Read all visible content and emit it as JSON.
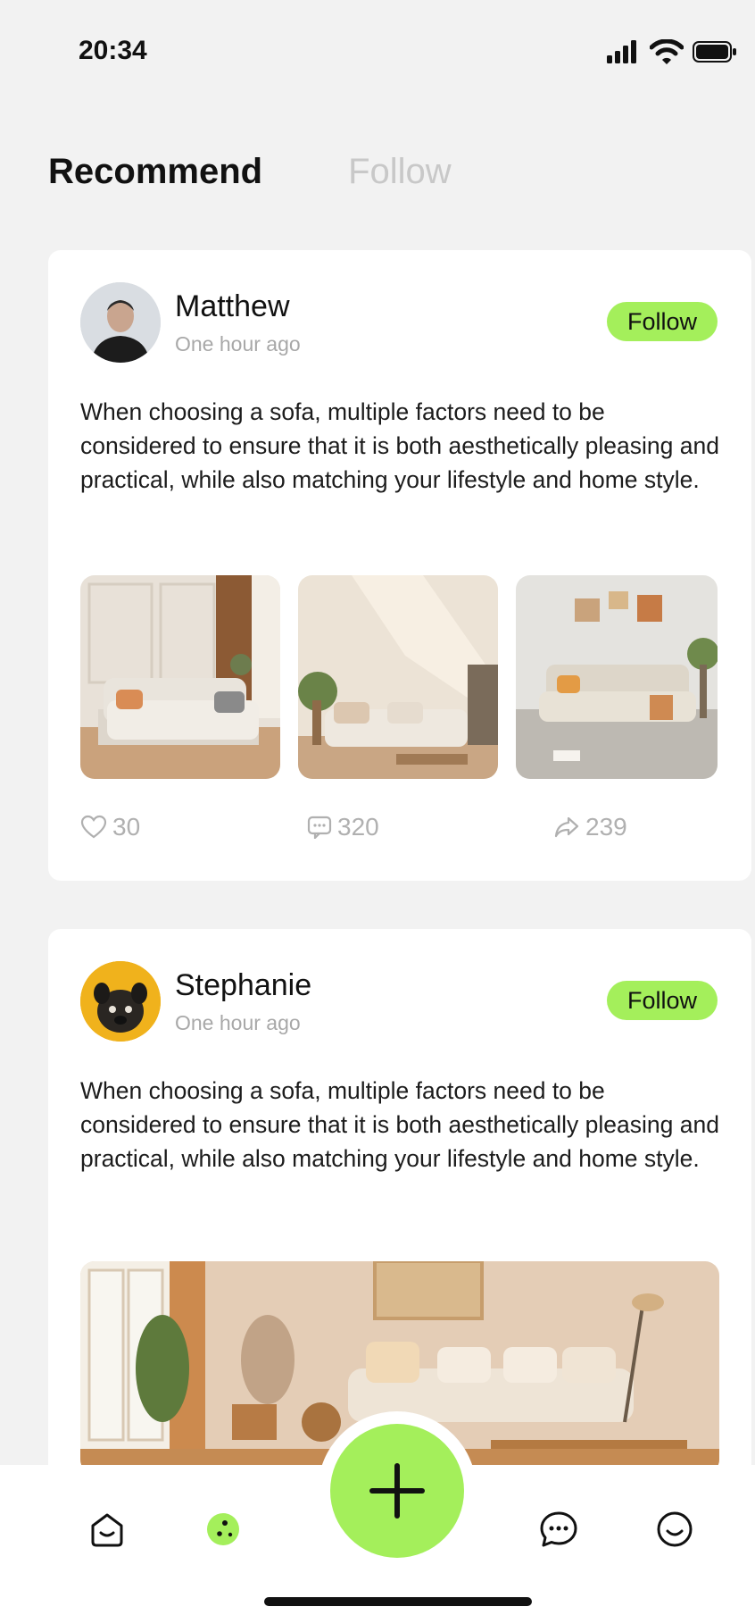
{
  "status_bar": {
    "time": "20:34"
  },
  "tabs": [
    {
      "label": "Recommend",
      "active": true
    },
    {
      "label": "Follow",
      "active": false
    }
  ],
  "posts": [
    {
      "author": "Matthew",
      "time": "One hour ago",
      "follow_label": "Follow",
      "text": "When choosing a sofa, multiple factors need to be considered to ensure that it is both aesthetically pleasing and practical, while also matching your lifestyle and home style.",
      "likes": "30",
      "comments": "320",
      "shares": "239"
    },
    {
      "author": "Stephanie",
      "time": "One hour ago",
      "follow_label": "Follow",
      "text": "When choosing a sofa, multiple factors need to be considered to ensure that it is both aesthetically pleasing and practical, while also matching your lifestyle and home style."
    }
  ],
  "bottom_nav": {
    "items": [
      "home-icon",
      "discover-icon",
      "add-icon",
      "messages-icon",
      "profile-icon"
    ]
  },
  "colors": {
    "accent": "#a4ef5b",
    "background": "#f2f2f2",
    "card": "#ffffff"
  }
}
